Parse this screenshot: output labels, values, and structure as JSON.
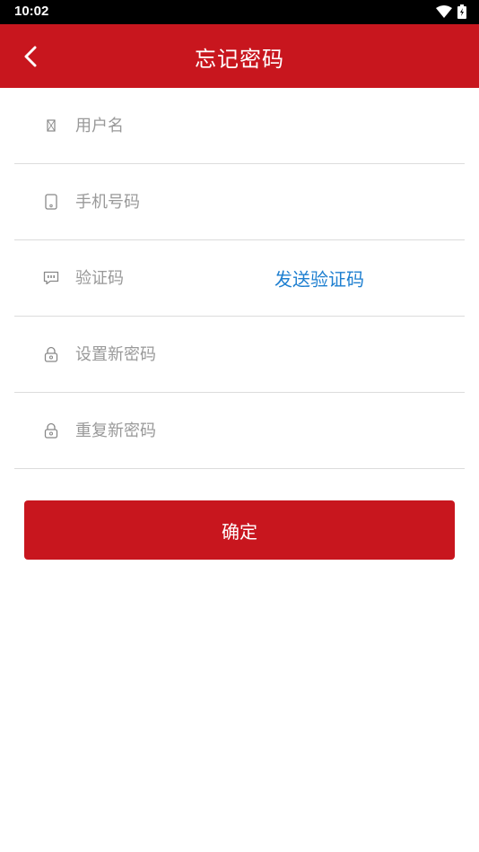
{
  "status_bar": {
    "time": "10:02"
  },
  "header": {
    "title": "忘记密码"
  },
  "form": {
    "username": {
      "placeholder": "用户名",
      "icon": "user-icon"
    },
    "phone": {
      "placeholder": "手机号码",
      "icon": "phone-icon"
    },
    "code": {
      "placeholder": "验证码",
      "icon": "message-icon",
      "send_label": "发送验证码"
    },
    "new_password": {
      "placeholder": "设置新密码",
      "icon": "lock-icon"
    },
    "repeat_password": {
      "placeholder": "重复新密码",
      "icon": "lock-icon"
    }
  },
  "confirm_label": "确定",
  "colors": {
    "brand": "#c8161e",
    "link": "#1e7fd0"
  }
}
